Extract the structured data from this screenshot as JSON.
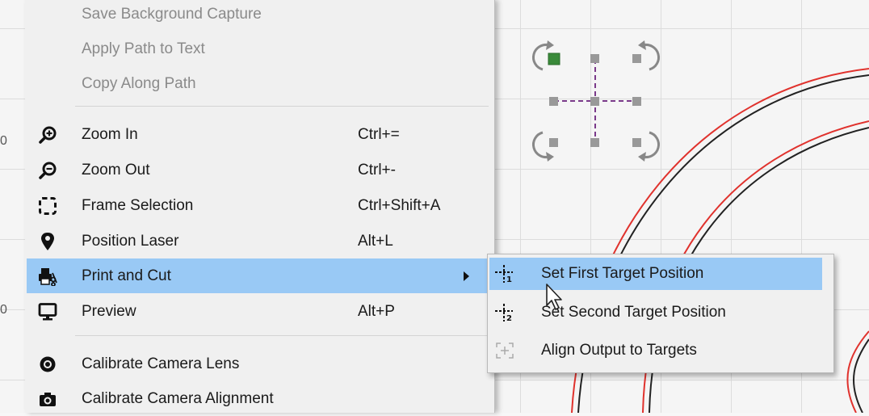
{
  "ruler": {
    "tick_1": "0",
    "tick_2": "0"
  },
  "menu": {
    "items": [
      {
        "label": "Save Background Capture",
        "shortcut": "",
        "icon": "",
        "disabled": true
      },
      {
        "label": "Apply Path to Text",
        "shortcut": "",
        "icon": "",
        "disabled": true
      },
      {
        "label": "Copy Along Path",
        "shortcut": "",
        "icon": "",
        "disabled": true
      },
      {
        "label": "Zoom In",
        "shortcut": "Ctrl+=",
        "icon": "zoom-in-icon"
      },
      {
        "label": "Zoom Out",
        "shortcut": "Ctrl+-",
        "icon": "zoom-out-icon"
      },
      {
        "label": "Frame Selection",
        "shortcut": "Ctrl+Shift+A",
        "icon": "frame-selection-icon"
      },
      {
        "label": "Position Laser",
        "shortcut": "Alt+L",
        "icon": "map-pin-icon"
      },
      {
        "label": "Print and Cut",
        "shortcut": "",
        "icon": "print-cut-icon",
        "highlighted": true,
        "submenu": true
      },
      {
        "label": "Preview",
        "shortcut": "Alt+P",
        "icon": "monitor-icon"
      },
      {
        "label": "Calibrate Camera Lens",
        "shortcut": "",
        "icon": "camera-lens-icon"
      },
      {
        "label": "Calibrate Camera Alignment",
        "shortcut": "",
        "icon": "camera-icon"
      }
    ]
  },
  "submenu": {
    "items": [
      {
        "label": "Set First Target Position",
        "icon": "target-1-icon",
        "highlighted": true
      },
      {
        "label": "Set Second Target Position",
        "icon": "target-2-icon"
      },
      {
        "label": "Align Output to Targets",
        "icon": "align-targets-icon",
        "disabled": true
      }
    ]
  },
  "colors": {
    "highlight": "#99c9f5",
    "menu_bg": "#f0f0f0",
    "cut_line": "#e0322d",
    "selected_handle": "#3a8a3a"
  }
}
